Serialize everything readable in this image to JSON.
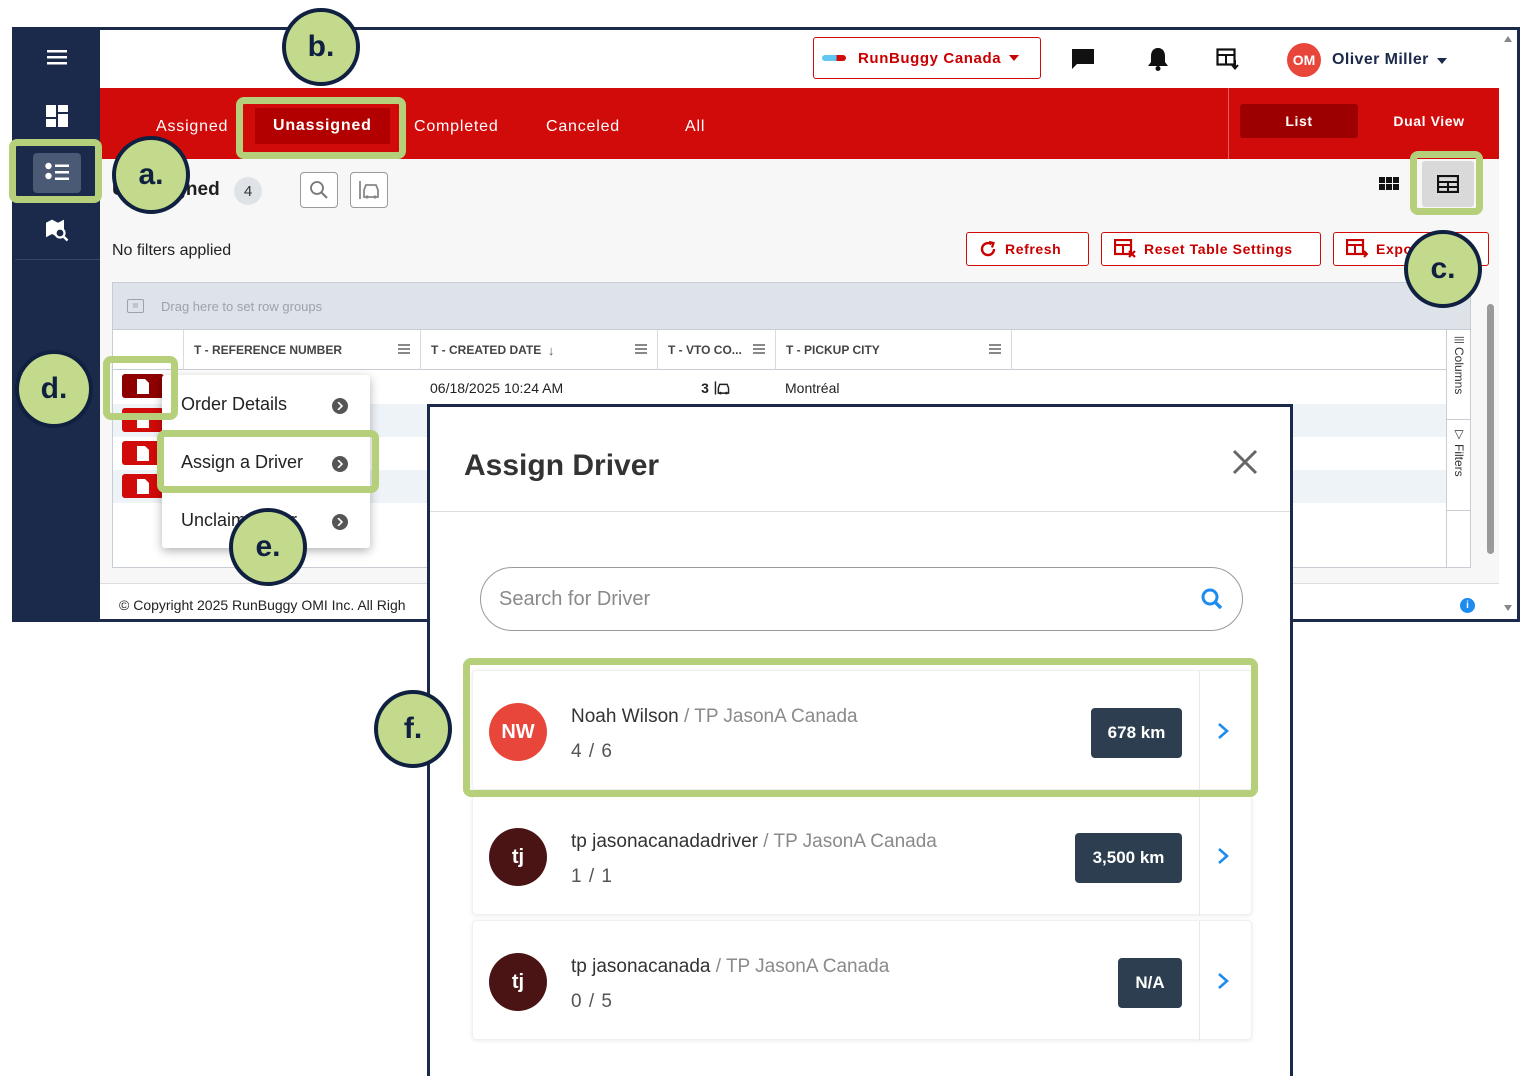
{
  "topbar": {
    "company_select": "RunBuggy Canada",
    "user_initials": "OM",
    "user_name": "Oliver Miller"
  },
  "tabs": [
    {
      "label": "Assigned"
    },
    {
      "label": "Unassigned"
    },
    {
      "label": "Completed"
    },
    {
      "label": "Canceled"
    },
    {
      "label": "All"
    }
  ],
  "view_modes": {
    "list": "List",
    "dual": "Dual View"
  },
  "page": {
    "title": "Unassigned",
    "count": "4",
    "filters_status": "No filters applied"
  },
  "actions": {
    "refresh": "Refresh",
    "reset_table": "Reset Table Settings",
    "export": "Export"
  },
  "grid": {
    "group_placeholder": "Drag here to set row groups",
    "columns": [
      "T - REFERENCE NUMBER",
      "T - CREATED DATE",
      "T - VTO CO...",
      "T - PICKUP CITY"
    ],
    "sort_indicator": "↓",
    "rows": [
      {
        "reference": "",
        "created": "06/18/2025 10:24 AM",
        "vto": "3",
        "pickup_city": "Montréal"
      }
    ],
    "side_columns": "Columns",
    "side_filters": "Filters"
  },
  "footer": {
    "copyright": "© Copyright 2025 RunBuggy OMI Inc. All Righ"
  },
  "context_menu": {
    "items": [
      "Order Details",
      "Assign a Driver",
      "Unclaim Order"
    ]
  },
  "modal": {
    "title": "Assign Driver",
    "search_placeholder": "Search for Driver",
    "drivers": [
      {
        "initials": "NW",
        "name": "Noah Wilson",
        "company": " / TP JasonA Canada",
        "load": "4 / 6",
        "distance": "678 km",
        "avatar_color": "#e8463a"
      },
      {
        "initials": "tj",
        "name": "tp jasonacanadadriver",
        "company": " / TP JasonA Canada",
        "load": "1 / 1",
        "distance": "3,500 km",
        "avatar_color": "#4a1414"
      },
      {
        "initials": "tj",
        "name": "tp jasonacanada",
        "company": " / TP JasonA Canada",
        "load": "0 / 5",
        "distance": "N/A",
        "avatar_color": "#4a1414"
      }
    ]
  },
  "callouts": {
    "a": "a.",
    "b": "b.",
    "c": "c.",
    "d": "d.",
    "e": "e.",
    "f": "f."
  },
  "colors": {
    "brand_red": "#d10a0a",
    "navy": "#1b2a4a",
    "highlight_green": "#b6cf7a",
    "callout_fill": "#c3d98c"
  }
}
